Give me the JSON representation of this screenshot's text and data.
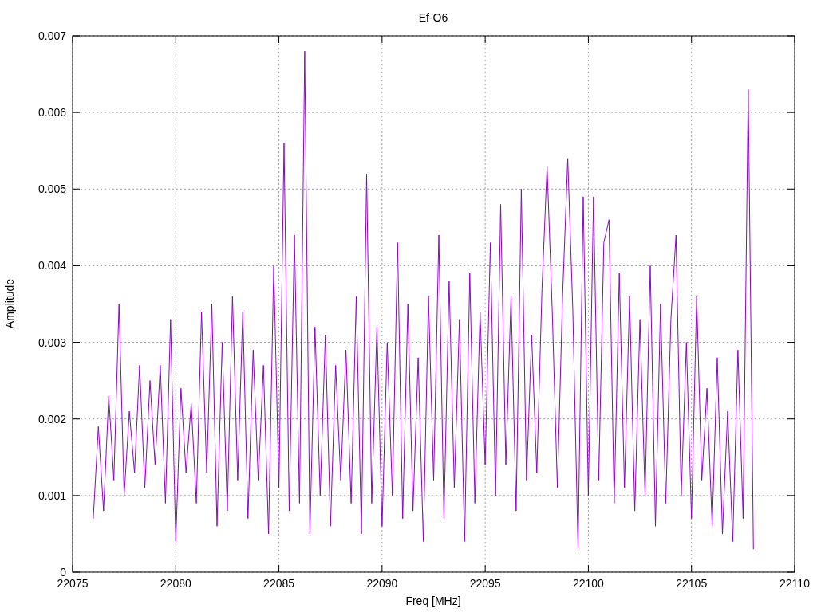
{
  "plot": {
    "chart_data": {
      "type": "line",
      "title": "Ef-O6",
      "xlabel": "Freq [MHz]",
      "ylabel": "Amplitude",
      "grid": true,
      "xlim": [
        22075,
        22110
      ],
      "ylim": [
        0,
        0.007
      ],
      "xticks": [
        22075,
        22080,
        22085,
        22090,
        22095,
        22100,
        22105,
        22110
      ],
      "yticks": [
        0,
        0.001,
        0.002,
        0.003,
        0.004,
        0.005,
        0.006,
        0.007
      ],
      "x": [
        22076,
        22076.25,
        22076.5,
        22076.75,
        22077,
        22077.25,
        22077.5,
        22077.75,
        22078,
        22078.25,
        22078.5,
        22078.75,
        22079,
        22079.25,
        22079.5,
        22079.75,
        22080,
        22080.25,
        22080.5,
        22080.75,
        22081,
        22081.25,
        22081.5,
        22081.75,
        22082,
        22082.25,
        22082.5,
        22082.75,
        22083,
        22083.25,
        22083.5,
        22083.75,
        22084,
        22084.25,
        22084.5,
        22084.75,
        22085,
        22085.25,
        22085.5,
        22085.75,
        22086,
        22086.25,
        22086.5,
        22086.75,
        22087,
        22087.25,
        22087.5,
        22087.75,
        22088,
        22088.25,
        22088.5,
        22088.75,
        22089,
        22089.25,
        22089.5,
        22089.75,
        22090,
        22090.25,
        22090.5,
        22090.75,
        22091,
        22091.25,
        22091.5,
        22091.75,
        22092,
        22092.25,
        22092.5,
        22092.75,
        22093,
        22093.25,
        22093.5,
        22093.75,
        22094,
        22094.25,
        22094.5,
        22094.75,
        22095,
        22095.25,
        22095.5,
        22095.75,
        22096,
        22096.25,
        22096.5,
        22096.75,
        22097,
        22097.25,
        22097.5,
        22097.75,
        22098,
        22098.25,
        22098.5,
        22098.75,
        22099,
        22099.25,
        22099.5,
        22099.75,
        22100,
        22100.25,
        22100.5,
        22100.75,
        22101,
        22101.25,
        22101.5,
        22101.75,
        22102,
        22102.25,
        22102.5,
        22102.75,
        22103,
        22103.25,
        22103.5,
        22103.75,
        22104,
        22104.25,
        22104.5,
        22104.75,
        22105,
        22105.25,
        22105.5,
        22105.75,
        22106,
        22106.25,
        22106.5,
        22106.75,
        22107,
        22107.25,
        22107.5,
        22107.75,
        22108
      ],
      "series": [
        {
          "color": "#9400d3",
          "values": [
            0.0007,
            0.0019,
            0.0008,
            0.0023,
            0.0012,
            0.0035,
            0.001,
            0.0021,
            0.0013,
            0.0027,
            0.0011,
            0.0025,
            0.0014,
            0.0027,
            0.0009,
            0.0033,
            0.0004,
            0.0024,
            0.0013,
            0.0022,
            0.0009,
            0.0034,
            0.0013,
            0.0035,
            0.0006,
            0.003,
            0.0008,
            0.0036,
            0.0012,
            0.0034,
            0.0007,
            0.0029,
            0.0012,
            0.0027,
            0.0005,
            0.004,
            0.0011,
            0.0056,
            0.0008,
            0.0044,
            0.0009,
            0.0068,
            0.0005,
            0.0032,
            0.001,
            0.0031,
            0.0006,
            0.0027,
            0.0012,
            0.0029,
            0.0009,
            0.0036,
            0.0005,
            0.0052,
            0.0009,
            0.0032,
            0.0006,
            0.003,
            0.001,
            0.0043,
            0.0007,
            0.0035,
            0.0008,
            0.0028,
            0.0004,
            0.0036,
            0.0012,
            0.0044,
            0.0007,
            0.0038,
            0.0011,
            0.0033,
            0.0004,
            0.0039,
            0.0009,
            0.0034,
            0.0014,
            0.0043,
            0.001,
            0.0048,
            0.0014,
            0.0036,
            0.0008,
            0.005,
            0.0012,
            0.0031,
            0.0013,
            0.0037,
            0.0053,
            0.0034,
            0.0011,
            0.0036,
            0.0054,
            0.0034,
            0.0003,
            0.0049,
            0.001,
            0.0049,
            0.0012,
            0.0043,
            0.0046,
            0.0009,
            0.0039,
            0.0011,
            0.0036,
            0.0008,
            0.0033,
            0.001,
            0.004,
            0.0006,
            0.0035,
            0.0009,
            0.0033,
            0.0044,
            0.001,
            0.003,
            0.0007,
            0.0036,
            0.0012,
            0.0024,
            0.0006,
            0.0028,
            0.0005,
            0.0021,
            0.0004,
            0.0029,
            0.0007,
            0.0063,
            0.0003
          ]
        }
      ]
    }
  }
}
